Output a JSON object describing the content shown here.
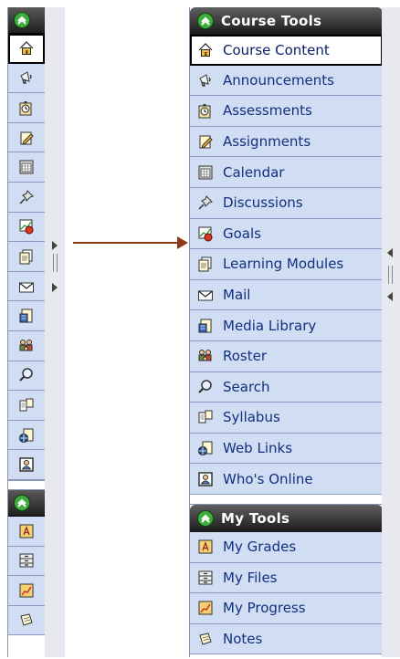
{
  "course_tools": {
    "title": "Course Tools",
    "items": [
      {
        "label": "Course Content",
        "icon": "home-icon",
        "selected": true
      },
      {
        "label": "Announcements",
        "icon": "megaphone-icon"
      },
      {
        "label": "Assessments",
        "icon": "stopwatch-icon"
      },
      {
        "label": "Assignments",
        "icon": "pencil-paper-icon"
      },
      {
        "label": "Calendar",
        "icon": "calendar-icon"
      },
      {
        "label": "Discussions",
        "icon": "pushpin-icon"
      },
      {
        "label": "Goals",
        "icon": "apple-chart-icon"
      },
      {
        "label": "Learning Modules",
        "icon": "documents-icon"
      },
      {
        "label": "Mail",
        "icon": "envelope-icon"
      },
      {
        "label": "Media Library",
        "icon": "film-document-icon"
      },
      {
        "label": "Roster",
        "icon": "people-icon"
      },
      {
        "label": "Search",
        "icon": "magnifier-icon"
      },
      {
        "label": "Syllabus",
        "icon": "open-book-icon"
      },
      {
        "label": "Web Links",
        "icon": "globe-document-icon"
      },
      {
        "label": "Who's Online",
        "icon": "online-person-icon"
      }
    ]
  },
  "my_tools": {
    "title": "My Tools",
    "items": [
      {
        "label": "My Grades",
        "icon": "grade-a-icon"
      },
      {
        "label": "My Files",
        "icon": "file-drawer-icon"
      },
      {
        "label": "My Progress",
        "icon": "progress-chart-icon"
      },
      {
        "label": "Notes",
        "icon": "note-icon"
      }
    ]
  },
  "colors": {
    "row_bg": "#d0ddf2",
    "label_text": "#12307f",
    "header_bg": "#1e1e1e",
    "header_icon": "#3fae3f",
    "arrow": "#8b3a1a"
  }
}
